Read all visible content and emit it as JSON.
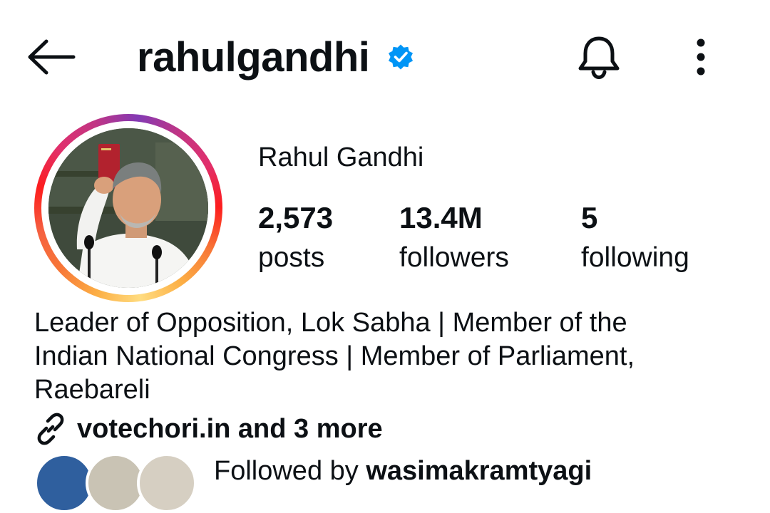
{
  "header": {
    "username": "rahulgandhi",
    "verified": true,
    "icons": [
      "back-arrow-icon",
      "verified-badge-icon",
      "bell-icon",
      "more-vertical-icon"
    ]
  },
  "profile": {
    "display_name": "Rahul Gandhi",
    "stats": {
      "posts": {
        "value": "2,573",
        "label": "posts"
      },
      "followers": {
        "value": "13.4M",
        "label": "followers"
      },
      "following": {
        "value": "5",
        "label": "following"
      }
    },
    "bio_lines": [
      "Leader of Opposition, Lok Sabha | Member of the",
      "Indian National Congress | Member of Parliament,",
      "Raebareli"
    ],
    "link_text": "votechori.in and 3 more",
    "followed_by_prefix": "Followed by ",
    "followed_by_user": "wasimakramtyagi"
  },
  "colors": {
    "verified_blue": "#0095f6",
    "text": "#0c1014",
    "story_ring_start": "#fcaf45",
    "story_ring_end": "#c13584"
  }
}
